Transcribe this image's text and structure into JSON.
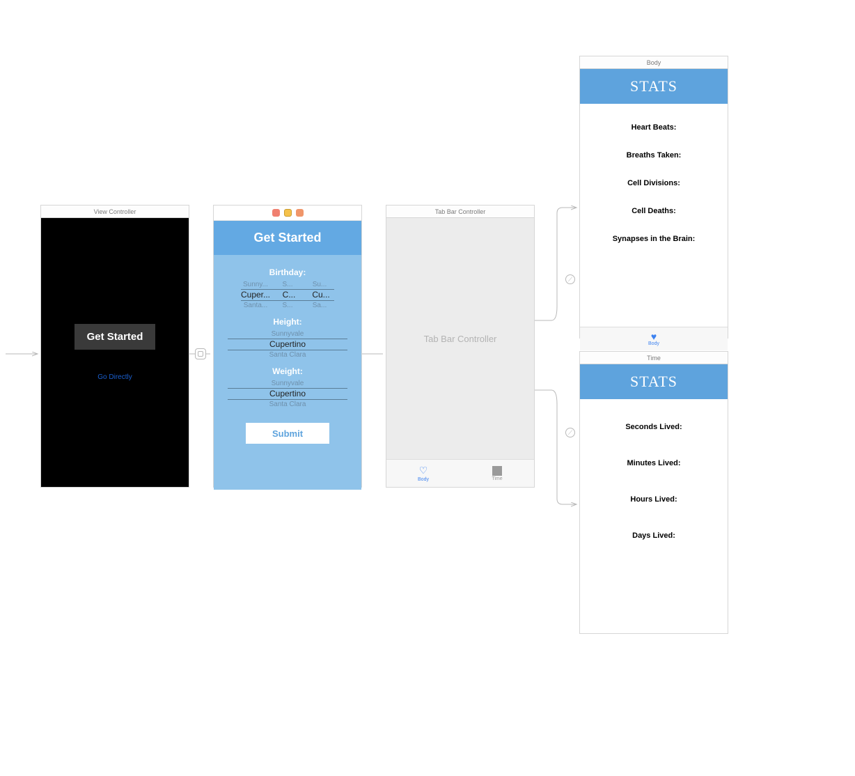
{
  "scene1": {
    "title": "View Controller",
    "get_started": "Get Started",
    "go_directly": "Go Directly"
  },
  "scene2": {
    "header": "Get Started",
    "birthday_label": "Birthday:",
    "birthday_faded_top": [
      "Sunny...",
      "S...",
      "Su..."
    ],
    "birthday_selected": [
      "Cuper...",
      "C...",
      "Cu..."
    ],
    "birthday_faded_bottom": [
      "Santa...",
      "S...",
      "Sa..."
    ],
    "height_label": "Height:",
    "height_faded_top": "Sunnyvale",
    "height_selected": "Cupertino",
    "height_faded_bottom": "Santa Clara",
    "weight_label": "Weight:",
    "weight_faded_top": "Sunnyvale",
    "weight_selected": "Cupertino",
    "weight_faded_bottom": "Santa Clara",
    "submit": "Submit"
  },
  "scene3": {
    "title": "Tab Bar Controller",
    "center": "Tab Bar Controller",
    "tab_body": "Body",
    "tab_time": "Time"
  },
  "scene4": {
    "title": "Body",
    "header": "STATS",
    "rows": {
      "r0": "Heart Beats:",
      "r1": "Breaths Taken:",
      "r2": "Cell Divisions:",
      "r3": "Cell Deaths:",
      "r4": "Synapses in the Brain:"
    },
    "tab_label": "Body"
  },
  "scene5": {
    "title": "Time",
    "header": "STATS",
    "rows": {
      "r0": "Seconds Lived:",
      "r1": "Minutes Lived:",
      "r2": "Hours Lived:",
      "r3": "Days Lived:"
    }
  }
}
